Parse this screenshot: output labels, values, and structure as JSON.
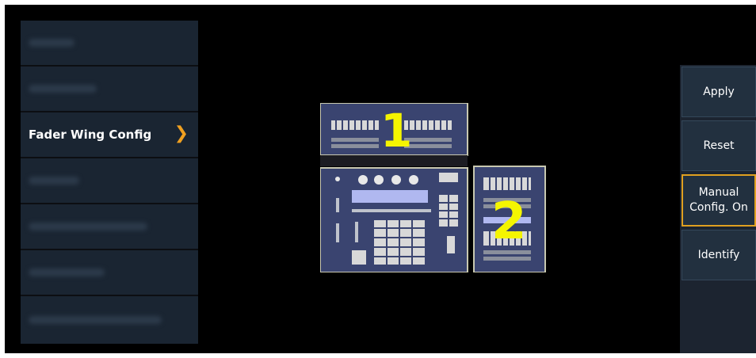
{
  "menu": {
    "items": [
      {
        "label": "",
        "blurred": true
      },
      {
        "label": "",
        "blurred": true
      },
      {
        "label": "Fader Wing Config",
        "blurred": false,
        "selected": true,
        "icon": "chevron-right-icon"
      },
      {
        "label": "",
        "blurred": true
      },
      {
        "label": "",
        "blurred": true
      },
      {
        "label": "",
        "blurred": true
      },
      {
        "label": "",
        "blurred": true
      }
    ]
  },
  "console": {
    "wing1_number": "1",
    "wing2_number": "2"
  },
  "buttons": {
    "apply": "Apply",
    "reset": "Reset",
    "manual_config": "Manual\nConfig. On",
    "identify": "Identify"
  },
  "colors": {
    "accent": "#f0a020",
    "number": "#f5f500",
    "panel": "#1a2532"
  }
}
